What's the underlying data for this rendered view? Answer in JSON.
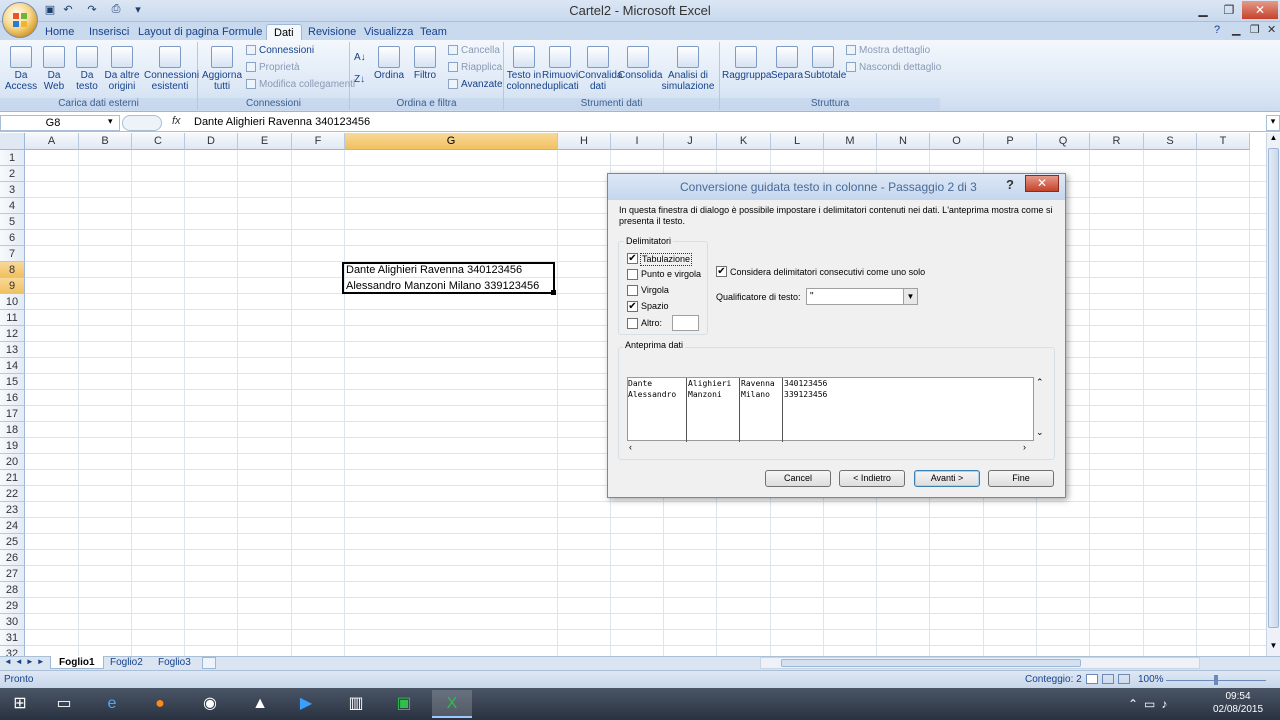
{
  "window": {
    "title": "Cartel2 - Microsoft Excel"
  },
  "tabs": [
    "Home",
    "Inserisci",
    "Layout di pagina",
    "Formule",
    "Dati",
    "Revisione",
    "Visualizza",
    "Team"
  ],
  "ribbon": {
    "groups": {
      "external": "Carica dati esterni",
      "connections": "Connessioni",
      "sort": "Ordina e filtra",
      "tools": "Strumenti dati",
      "outline": "Struttura"
    },
    "external": {
      "access": "Da Access",
      "web": "Da Web",
      "text": "Da testo",
      "other": "Da altre origini",
      "existing": "Connessioni esistenti"
    },
    "connections": {
      "refresh": "Aggiorna tutti",
      "conn": "Connessioni",
      "props": "Proprietà",
      "edit": "Modifica collegamenti"
    },
    "sort": {
      "sort": "Ordina",
      "filter": "Filtro",
      "clear": "Cancella",
      "reapply": "Riapplica",
      "advanced": "Avanzate"
    },
    "tools": {
      "text_to_cols": "Testo in colonne",
      "remove_dup": "Rimuovi duplicati",
      "validation": "Convalida dati",
      "consolidate": "Consolida",
      "whatif": "Analisi di simulazione"
    },
    "outline": {
      "group": "Raggruppa",
      "ungroup": "Separa",
      "subtotal": "Subtotale",
      "show": "Mostra dettaglio",
      "hide": "Nascondi dettaglio"
    }
  },
  "formula_bar": {
    "name_box": "G8",
    "fx": "fx",
    "content": "Dante Alighieri Ravenna 340123456"
  },
  "columns": [
    "A",
    "B",
    "C",
    "D",
    "E",
    "F",
    "G",
    "H",
    "I",
    "J",
    "K",
    "L",
    "M",
    "N",
    "O",
    "P",
    "Q",
    "R",
    "S",
    "T"
  ],
  "rows": [
    "1",
    "2",
    "3",
    "4",
    "5",
    "6",
    "7",
    "8",
    "9",
    "10",
    "11",
    "12",
    "13",
    "14",
    "15",
    "16",
    "17",
    "18",
    "19",
    "20",
    "21",
    "22",
    "23",
    "24",
    "25",
    "26",
    "27",
    "28",
    "29",
    "30",
    "31",
    "32"
  ],
  "cells": {
    "g8": "Dante Alighieri Ravenna 340123456",
    "g9": "Alessandro Manzoni Milano 339123456"
  },
  "sheets": [
    "Foglio1",
    "Foglio2",
    "Foglio3"
  ],
  "status": {
    "ready": "Pronto",
    "count": "Conteggio: 2",
    "zoom": "100%"
  },
  "clock": {
    "time": "09:54",
    "date": "02/08/2015"
  },
  "dialog": {
    "title": "Conversione guidata testo in colonne - Passaggio 2 di 3",
    "help": "?",
    "intro": "In questa finestra di dialogo è possibile impostare i delimitatori contenuti nei dati. L'anteprima mostra come si presenta il testo.",
    "delimiters_label": "Delimitatori",
    "tab": "Tabulazione",
    "semicolon": "Punto e virgola",
    "comma": "Virgola",
    "space": "Spazio",
    "other": "Altro:",
    "consecutive": "Considera delimitatori consecutivi come uno solo",
    "qualifier_label": "Qualificatore di testo:",
    "qualifier_value": "\"",
    "preview_label": "Anteprima dati",
    "preview": {
      "c1": "Dante\nAlessandro",
      "c2": "Alighieri\nManzoni",
      "c3": "Ravenna\nMilano",
      "c4": "340123456\n339123456"
    },
    "buttons": {
      "cancel": "Cancel",
      "back": "< Indietro",
      "next": "Avanti >",
      "finish": "Fine"
    }
  }
}
